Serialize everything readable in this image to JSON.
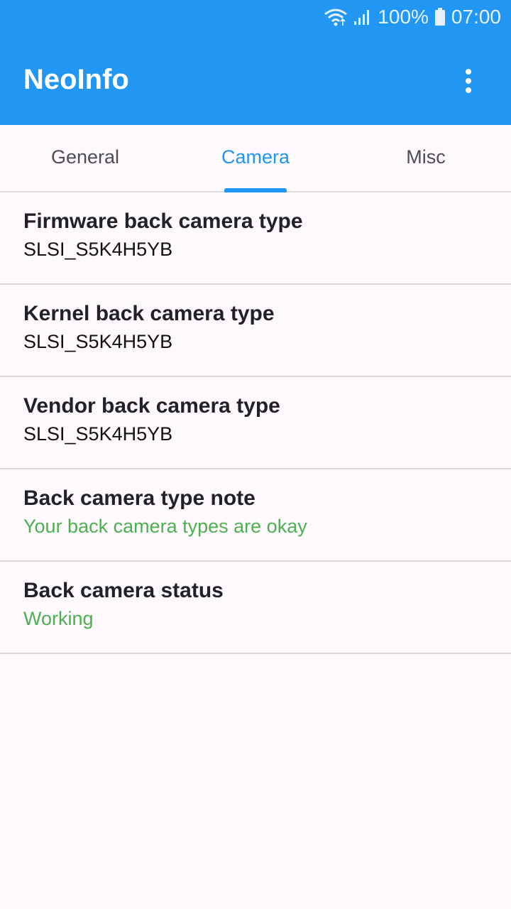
{
  "status_bar": {
    "wifi_icon": "wifi-icon",
    "signal_icon": "signal-icon",
    "battery_percent": "100%",
    "battery_icon": "battery-icon",
    "time": "07:00"
  },
  "app_bar": {
    "title": "NeoInfo",
    "menu_icon": "more-vert-icon"
  },
  "tabs": [
    {
      "label": "General",
      "active": false
    },
    {
      "label": "Camera",
      "active": true
    },
    {
      "label": "Misc",
      "active": false
    }
  ],
  "items": [
    {
      "title": "Firmware back camera type",
      "value": "SLSI_S5K4H5YB"
    },
    {
      "title": "Kernel back camera type",
      "value": "SLSI_S5K4H5YB"
    },
    {
      "title": "Vendor back camera type",
      "value": "SLSI_S5K4H5YB"
    },
    {
      "title": "Back camera type note",
      "value": "Your back camera types are okay"
    },
    {
      "title": "Back camera status",
      "value": "Working"
    }
  ],
  "colors": {
    "primary": "#2196f3",
    "ok_text": "#4caf50",
    "background": "#fdf9fd"
  }
}
